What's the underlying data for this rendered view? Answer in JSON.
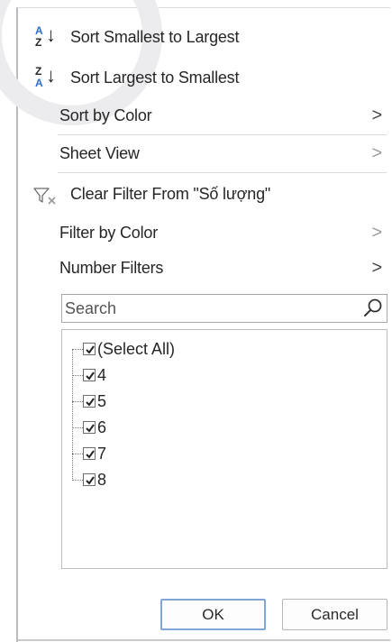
{
  "menu": {
    "sort_asc": {
      "label": "Sort Smallest to Largest",
      "icon": "sort-ascending-icon",
      "icon_top": "A",
      "icon_bottom": "Z"
    },
    "sort_desc": {
      "label": "Sort Largest to Smallest",
      "icon": "sort-descending-icon",
      "icon_top": "Z",
      "icon_bottom": "A"
    },
    "sort_by_color": {
      "label": "Sort by Color",
      "chevron": ">"
    },
    "sheet_view": {
      "label": "Sheet View",
      "chevron": ">"
    },
    "clear_filter": {
      "label": "Clear Filter From \"Số lượng\"",
      "icon": "clear-filter-icon"
    },
    "filter_by_color": {
      "label": "Filter by Color",
      "chevron": ">"
    },
    "number_filters": {
      "label": "Number Filters",
      "chevron": ">"
    }
  },
  "search": {
    "placeholder": "Search",
    "value": ""
  },
  "values_list": [
    {
      "label": "(Select All)",
      "checked": true
    },
    {
      "label": "4",
      "checked": true
    },
    {
      "label": "5",
      "checked": true
    },
    {
      "label": "6",
      "checked": true
    },
    {
      "label": "7",
      "checked": true
    },
    {
      "label": "8",
      "checked": true
    }
  ],
  "buttons": {
    "ok": "OK",
    "cancel": "Cancel"
  },
  "colors": {
    "accent": "#2f6ec7",
    "ok_border": "#7fa6d6"
  }
}
